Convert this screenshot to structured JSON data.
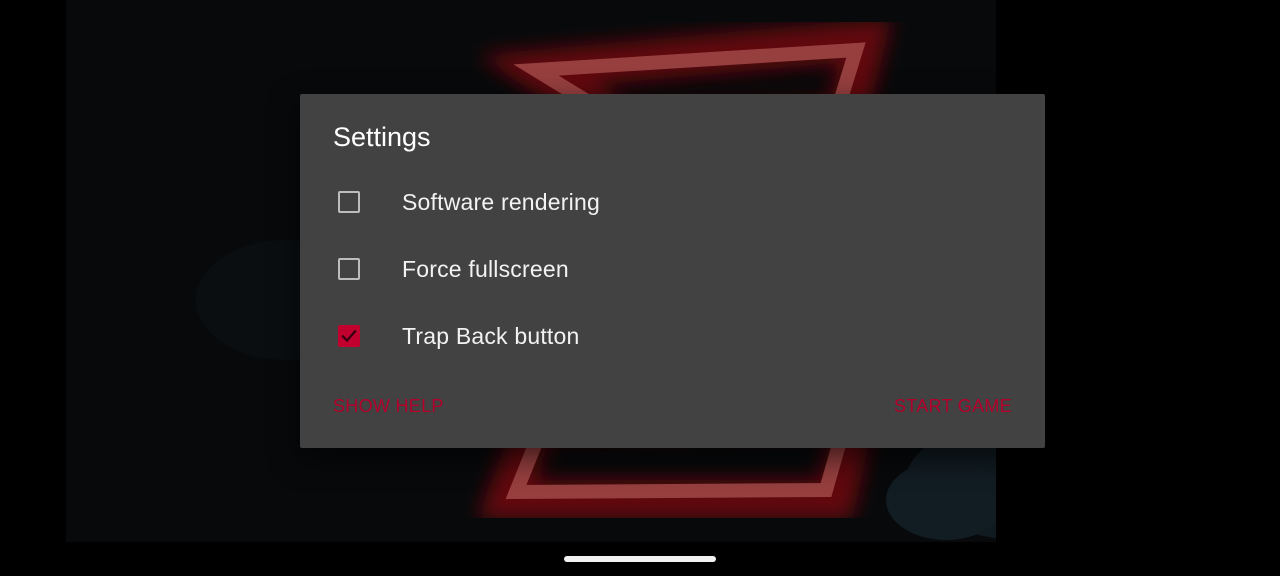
{
  "dialog": {
    "title": "Settings",
    "options": [
      {
        "label": "Software rendering",
        "checked": false
      },
      {
        "label": "Force fullscreen",
        "checked": false
      },
      {
        "label": "Trap Back button",
        "checked": true
      }
    ],
    "show_help_label": "SHOW HELP",
    "start_game_label": "START GAME"
  },
  "colors": {
    "accent": "#c2002f",
    "dialog_background": "#424242",
    "logo_glow": "#e0282f"
  },
  "icons": {
    "checkbox_checked": "check-icon",
    "background_logo": "game-logo"
  }
}
